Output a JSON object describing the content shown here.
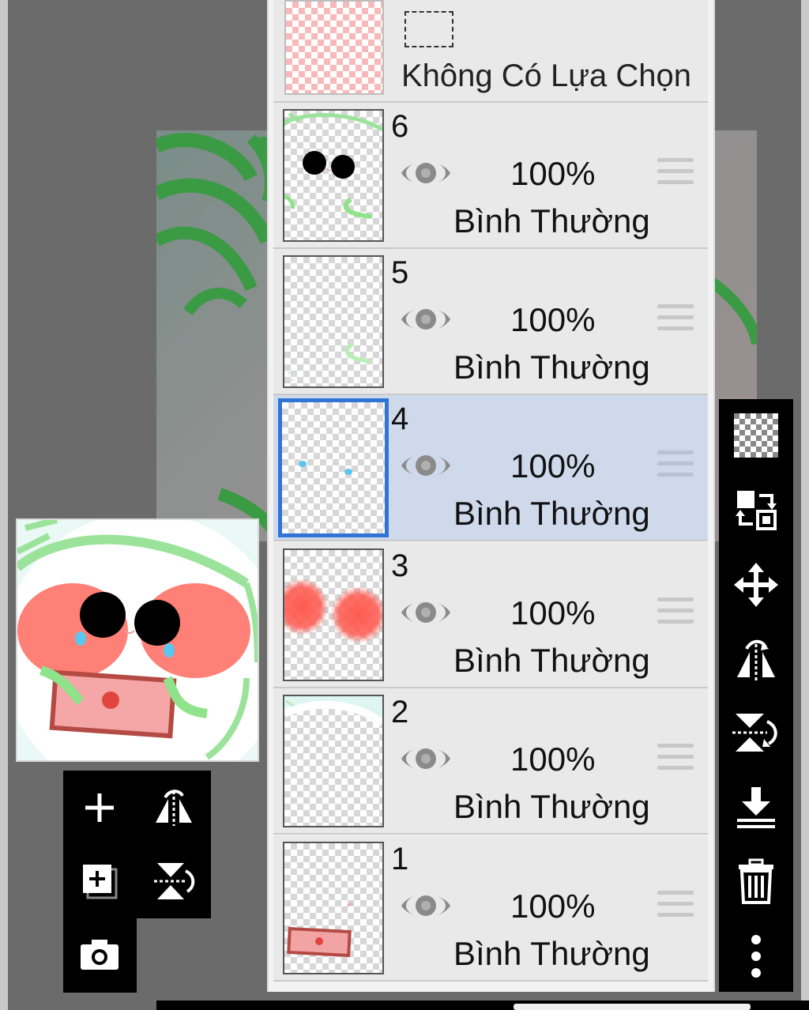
{
  "selection_layer": {
    "label": "Không Có Lựa Chọn"
  },
  "layers": [
    {
      "number": "6",
      "opacity": "100%",
      "blend_mode": "Bình Thường",
      "active": false
    },
    {
      "number": "5",
      "opacity": "100%",
      "blend_mode": "Bình Thường",
      "active": false
    },
    {
      "number": "4",
      "opacity": "100%",
      "blend_mode": "Bình Thường",
      "active": true
    },
    {
      "number": "3",
      "opacity": "100%",
      "blend_mode": "Bình Thường",
      "active": false
    },
    {
      "number": "2",
      "opacity": "100%",
      "blend_mode": "Bình Thường",
      "active": false
    },
    {
      "number": "1",
      "opacity": "100%",
      "blend_mode": "Bình Thường",
      "active": false
    }
  ],
  "left_toolbar": {
    "buttons": [
      "add-layer-icon",
      "flip-horizontal-icon",
      "add-layer-copy-icon",
      "flip-vertical-icon",
      "camera-icon"
    ]
  },
  "right_toolbar": {
    "buttons": [
      "transparency-checker-icon",
      "swap-layer-icon",
      "move-icon",
      "flip-horizontal-icon",
      "flip-vertical-icon",
      "merge-down-icon",
      "trash-icon",
      "more-options-icon"
    ]
  },
  "colors": {
    "accent": "#2f74d6",
    "active_row": "#cfd9ec",
    "panel_bg": "#e9e9e9",
    "toolbar_bg": "#000000",
    "artwork_green": "#8fe38a",
    "blush_red": "#ff5a4f"
  }
}
